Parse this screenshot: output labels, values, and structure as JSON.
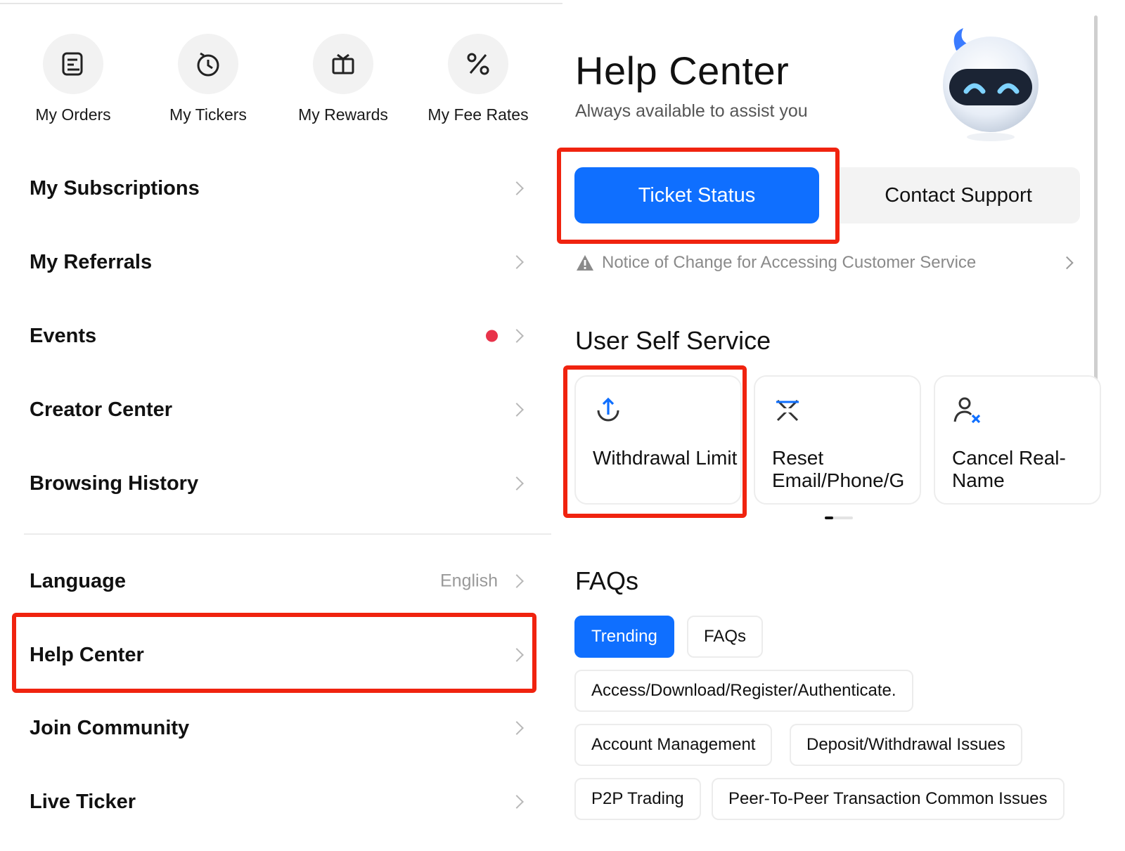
{
  "left": {
    "shortcuts": [
      {
        "label": "My Orders",
        "icon": "orders-icon"
      },
      {
        "label": "My Tickers",
        "icon": "clock-icon"
      },
      {
        "label": "My Rewards",
        "icon": "gift-icon"
      },
      {
        "label": "My Fee Rates",
        "icon": "percent-icon"
      }
    ],
    "menu": [
      {
        "label": "My Subscriptions"
      },
      {
        "label": "My Referrals"
      },
      {
        "label": "Events"
      },
      {
        "label": "Creator Center"
      },
      {
        "label": "Browsing History"
      },
      {
        "label": "Language",
        "value": "English"
      },
      {
        "label": "Help Center"
      },
      {
        "label": "Join Community"
      },
      {
        "label": "Live Ticker"
      }
    ]
  },
  "help": {
    "title": "Help Center",
    "subtitle": "Always available to assist you",
    "tabs": {
      "ticket_status": "Ticket Status",
      "contact_support": "Contact Support"
    },
    "notice": "Notice of Change for Accessing Customer Service",
    "self_service": {
      "title": "User Self Service",
      "cards": [
        {
          "label": "Withdrawal Limit",
          "icon": "upload-arrow-icon"
        },
        {
          "label": "Reset Email/Phone/G",
          "icon": "reset-icon"
        },
        {
          "label": "Cancel Real-Name",
          "icon": "user-remove-icon"
        }
      ]
    },
    "faqs": {
      "title": "FAQs",
      "tabs": [
        "Trending",
        "FAQs"
      ],
      "topics": [
        "Access/Download/Register/Authenticate.",
        "Account Management",
        "Deposit/Withdrawal Issues",
        "P2P Trading",
        "Peer-To-Peer Transaction Common Issues"
      ]
    }
  },
  "colors": {
    "accent": "#0f6fff",
    "highlight": "#f0230f",
    "badge": "#e8334a"
  }
}
